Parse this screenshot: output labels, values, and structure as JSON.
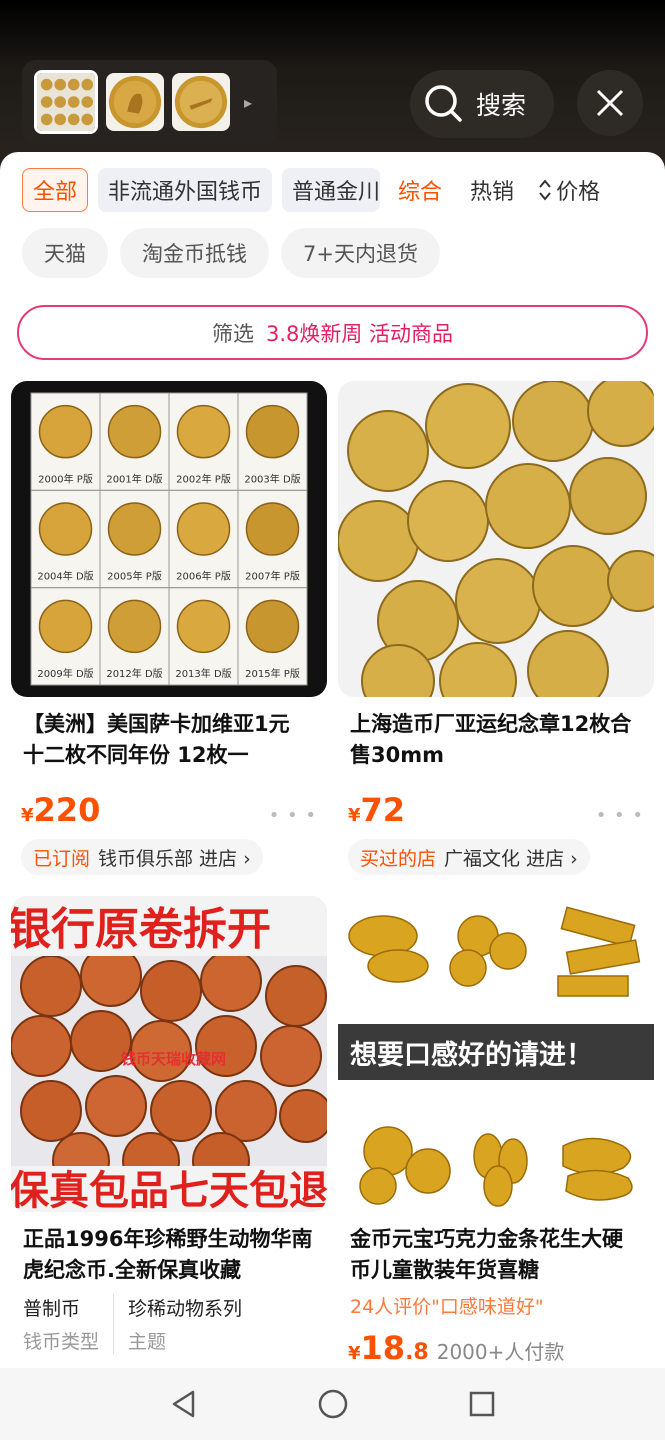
{
  "top": {
    "search_label": "搜索",
    "thumbnails": [
      "thumb-1",
      "thumb-2",
      "thumb-3"
    ]
  },
  "filters": {
    "chips": [
      "全部",
      "非流通外国钱币",
      "普通金川"
    ],
    "sort": [
      "综合",
      "热销",
      "价格"
    ]
  },
  "tags": [
    "天猫",
    "淘金币抵钱",
    "7+天内退货"
  ],
  "screen": {
    "label": "筛选",
    "promo": "3.8焕新周 活动商品"
  },
  "products": [
    {
      "title": "【美洲】美国萨卡加维亚1元 十二枚不同年份 12枚一",
      "currency": "¥",
      "price": "220",
      "badge": "已订阅",
      "shop": "钱币俱乐部",
      "enter": "进店 ›",
      "grid_labels": [
        "2000年 P版",
        "2001年 D版",
        "2002年 P版",
        "2003年 D版",
        "2004年 D版",
        "2005年 P版",
        "2006年 P版",
        "2007年 P版",
        "2009年 D版",
        "2012年 D版",
        "2013年 D版",
        "2015年 P版"
      ]
    },
    {
      "title": "上海造币厂亚运纪念章12枚合售30mm",
      "currency": "¥",
      "price": "72",
      "badge": "买过的店",
      "shop": "广福文化",
      "enter": "进店 ›"
    },
    {
      "title": "正品1996年珍稀野生动物华南虎纪念币.全新保真收藏",
      "banner_top": "银行原卷拆开",
      "banner_bottom": "保真包品七天包退",
      "watermark": "钱币天瑞收藏网",
      "attrs": [
        {
          "value": "普制币",
          "key": "钱币类型"
        },
        {
          "value": "珍稀动物系列",
          "key": "主题"
        }
      ]
    },
    {
      "title": "金币元宝巧克力金条花生大硬币儿童散装年货喜糖",
      "banner": "想要口感好的请进！",
      "review": "24人评价\"口感味道好\"",
      "currency": "¥",
      "price_int": "18",
      "price_dec": ".8",
      "sold": "2000+人付款"
    }
  ]
}
